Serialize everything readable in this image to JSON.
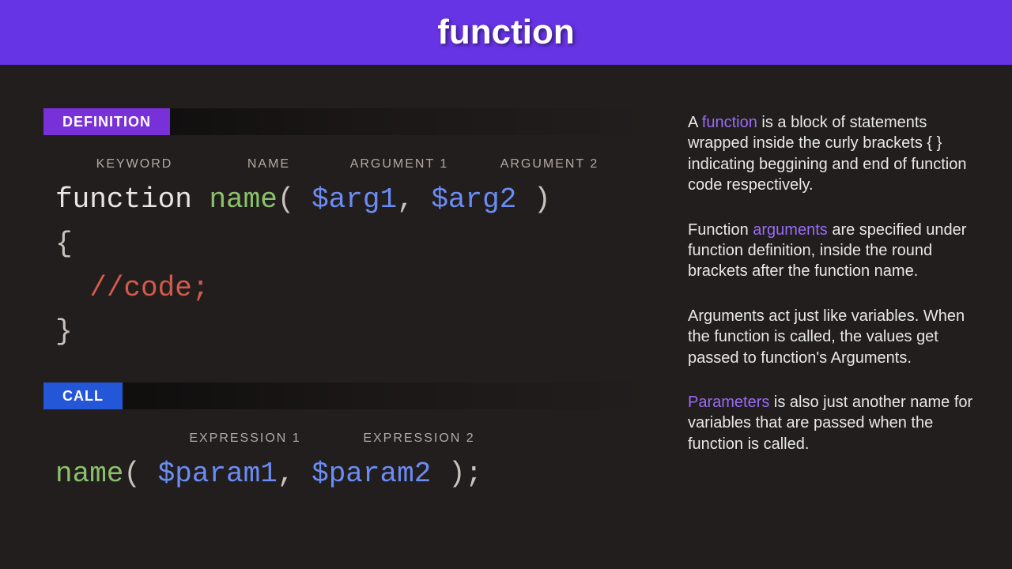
{
  "header": {
    "title": "function"
  },
  "tags": {
    "definition": "DEFINITION",
    "call": "CALL"
  },
  "annotations": {
    "def": {
      "keyword": "KEYWORD",
      "name": "NAME",
      "arg1": "ARGUMENT 1",
      "arg2": "ARGUMENT 2"
    },
    "call": {
      "expr1": "EXPRESSION 1",
      "expr2": "EXPRESSION 2"
    }
  },
  "code": {
    "def": {
      "keyword": "function",
      "name": "name",
      "open_paren": "(",
      "arg1": "$arg1",
      "comma": ",",
      "arg2": "$arg2",
      "close_paren": ")",
      "open_brace": "{",
      "comment": "//code;",
      "close_brace": "}"
    },
    "call": {
      "name": "name",
      "open_paren": "(",
      "param1": "$param1",
      "comma": ",",
      "param2": "$param2",
      "close": ");"
    }
  },
  "desc": {
    "p1_a": "A ",
    "p1_hl": "function",
    "p1_b": " is a block of statements wrapped inside the curly brackets {  } indicating beggining and end of function code respectively.",
    "p2_a": "Function ",
    "p2_hl": "arguments",
    "p2_b": " are specified under function definition, inside the round brackets after the function name.",
    "p3": "Arguments act just like variables. When the function is called, the values get passed to function's Arguments.",
    "p4_hl": "Parameters",
    "p4_b": " is also just another name for variables that are passed when the function is called."
  }
}
